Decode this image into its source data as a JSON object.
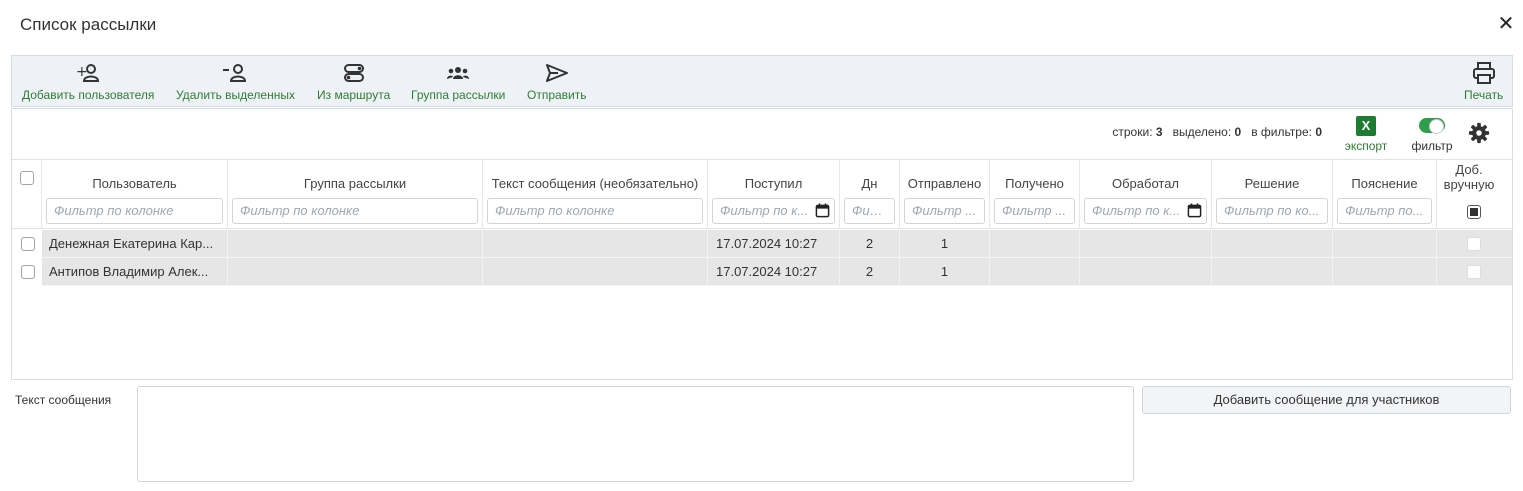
{
  "dialog": {
    "title": "Список рассылки",
    "close_glyph": "✕"
  },
  "toolbar": {
    "add_user": "Добавить пользователя",
    "delete_selected": "Удалить выделенных",
    "from_route": "Из маршрута",
    "mailing_group": "Группа рассылки",
    "send": "Отправить",
    "print": "Печать"
  },
  "stats": {
    "rows_label": "строки:",
    "rows_value": "3",
    "selected_label": "выделено:",
    "selected_value": "0",
    "filtered_label": "в фильтре:",
    "filtered_value": "0"
  },
  "export": {
    "glyph": "X",
    "label": "экспорт"
  },
  "filter_toggle": {
    "label": "фильтр",
    "enabled": true
  },
  "columns": {
    "user": "Пользователь",
    "group": "Группа рассылки",
    "text": "Текст сообщения (необязательно)",
    "received": "Поступил",
    "days": "Дн",
    "sent": "Отправлено",
    "got": "Получено",
    "processed": "Обработал",
    "decision": "Решение",
    "explanation": "Пояснение",
    "manual": "Доб. вручную"
  },
  "filters": {
    "user": "Фильтр по колонке",
    "group": "Фильтр по колонке",
    "text": "Фильтр по колонке",
    "received": "Фильтр по к...",
    "days": "Фил...",
    "sent": "Фильтр ...",
    "got": "Фильтр ...",
    "processed": "Фильтр по к...",
    "decision": "Фильтр по ко...",
    "explanation": "Фильтр по..."
  },
  "rows": [
    {
      "user": "Денежная Екатерина Кар...",
      "group": "",
      "text": "",
      "received": "17.07.2024 10:27",
      "days": "2",
      "sent": "1",
      "got": "",
      "processed": "",
      "decision": "",
      "explanation": ""
    },
    {
      "user": "Антипов Владимир Алек...",
      "group": "",
      "text": "",
      "received": "17.07.2024 10:27",
      "days": "2",
      "sent": "1",
      "got": "",
      "processed": "",
      "decision": "",
      "explanation": ""
    }
  ],
  "message": {
    "label": "Текст сообщения",
    "value": "",
    "add_button": "Добавить сообщение для участников"
  },
  "colors": {
    "accent": "#2e7d32",
    "toolbar_bg": "#eef2f7",
    "row_bg": "#e6e6e6"
  },
  "icons": [
    "user-plus-icon",
    "user-minus-icon",
    "route-icon",
    "group-icon",
    "send-icon",
    "print-icon",
    "excel-icon",
    "gear-icon",
    "calendar-icon",
    "close-icon"
  ]
}
